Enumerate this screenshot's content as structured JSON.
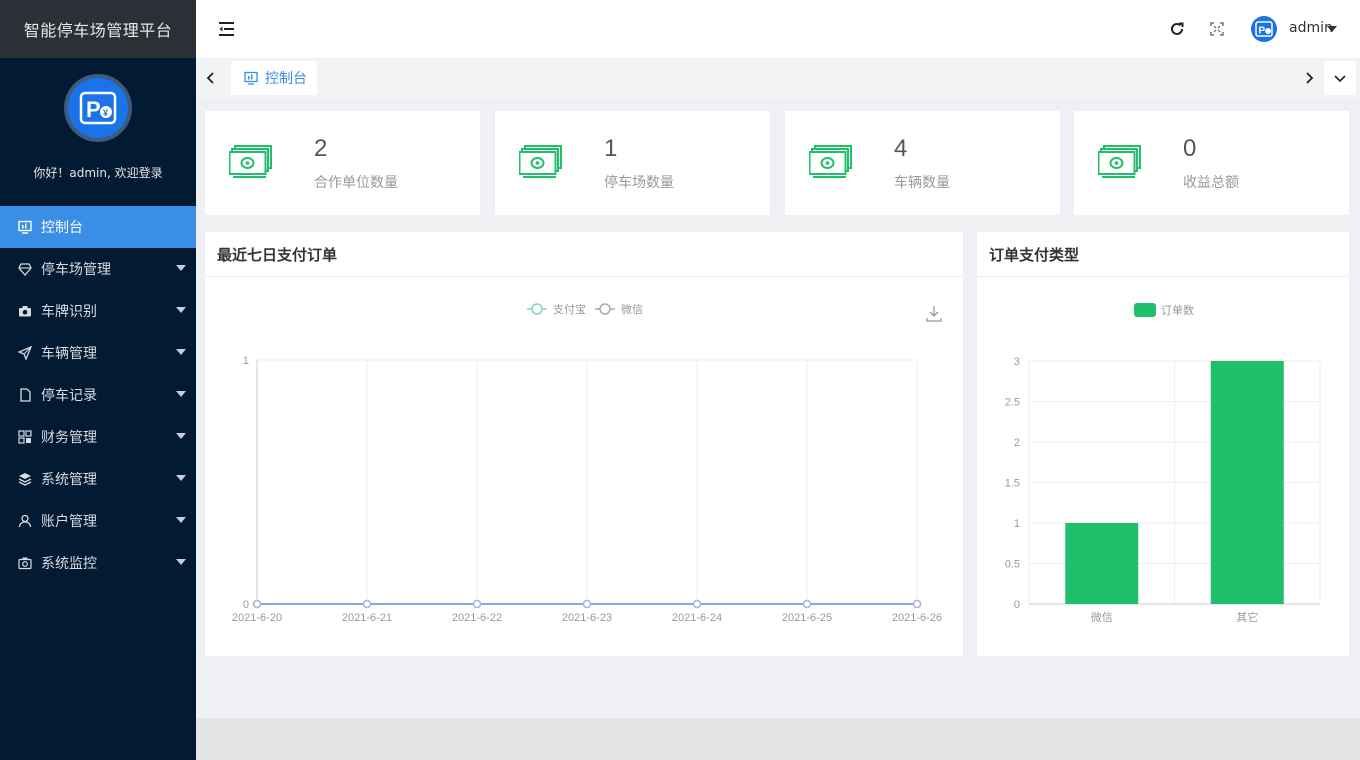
{
  "sidebar": {
    "brand": "智能停车场管理平台",
    "welcome": "你好！admin, 欢迎登录",
    "items": [
      {
        "label": "控制台",
        "icon": "monitor-icon",
        "active": true
      },
      {
        "label": "停车场管理",
        "icon": "diamond-icon"
      },
      {
        "label": "车牌识别",
        "icon": "camera-icon"
      },
      {
        "label": "车辆管理",
        "icon": "send-icon"
      },
      {
        "label": "停车记录",
        "icon": "document-icon"
      },
      {
        "label": "财务管理",
        "icon": "grid-icon"
      },
      {
        "label": "系统管理",
        "icon": "layers-icon"
      },
      {
        "label": "账户管理",
        "icon": "user-icon"
      },
      {
        "label": "系统监控",
        "icon": "camera-outline-icon"
      }
    ]
  },
  "header": {
    "username": "admin"
  },
  "tags": {
    "active_tab": "控制台"
  },
  "stats": [
    {
      "value": "2",
      "label": "合作单位数量"
    },
    {
      "value": "1",
      "label": "停车场数量"
    },
    {
      "value": "4",
      "label": "车辆数量"
    },
    {
      "value": "0",
      "label": "收益总额"
    }
  ],
  "colors": {
    "accent": "#3b8ee6",
    "sidebar_bg": "#031a33",
    "bar_green": "#20bf6b",
    "alipay_line": "#7fd4c1",
    "wechat_line": "#a8a8a8"
  },
  "line_panel": {
    "title": "最近七日支付订单"
  },
  "bar_panel": {
    "title": "订单支付类型"
  },
  "chart_data": [
    {
      "type": "line",
      "x": [
        "2021-6-20",
        "2021-6-21",
        "2021-6-22",
        "2021-6-23",
        "2021-6-24",
        "2021-6-25",
        "2021-6-26"
      ],
      "series": [
        {
          "name": "支付宝",
          "values": [
            0,
            0,
            0,
            0,
            0,
            0,
            0
          ]
        },
        {
          "name": "微信",
          "values": [
            0,
            0,
            0,
            0,
            0,
            0,
            0
          ]
        }
      ],
      "ylim": [
        0,
        1
      ],
      "yticks": [
        "0",
        "1"
      ],
      "grid": true,
      "legend": "top-center"
    },
    {
      "type": "bar",
      "categories": [
        "微信",
        "其它"
      ],
      "series": [
        {
          "name": "订单数",
          "values": [
            1,
            3
          ]
        }
      ],
      "ylim": [
        0,
        3
      ],
      "yticks": [
        "0",
        "0.5",
        "1",
        "1.5",
        "2",
        "2.5",
        "3"
      ],
      "grid": true,
      "legend": "top-center"
    }
  ]
}
